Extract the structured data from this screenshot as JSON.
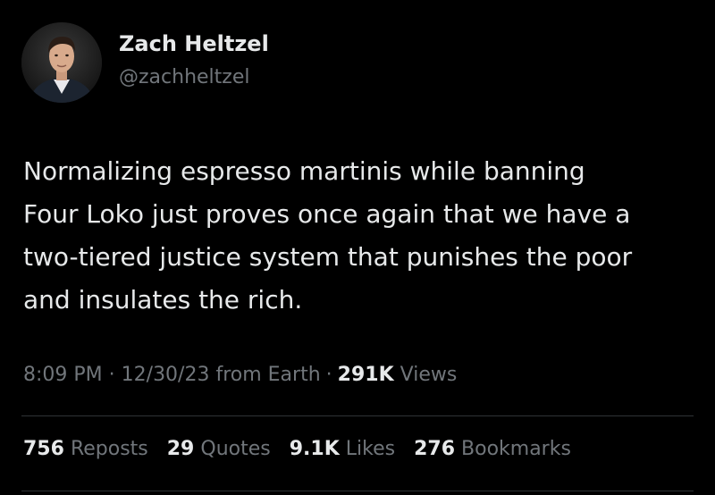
{
  "author": {
    "display_name": "Zach Heltzel",
    "handle": "@zachheltzel",
    "avatar_icon": "profile-photo"
  },
  "tweet": {
    "text": "Normalizing espresso martinis while banning\nFour Loko just proves once again that we have a\ntwo-tiered justice system that punishes the poor\nand insulates the rich."
  },
  "meta": {
    "time": "8:09 PM",
    "separator": "·",
    "date": "12/30/23",
    "source": "from Earth",
    "views_count": "291K",
    "views_label": "Views"
  },
  "stats": {
    "reposts_count": "756",
    "reposts_label": "Reposts",
    "quotes_count": "29",
    "quotes_label": "Quotes",
    "likes_count": "9.1K",
    "likes_label": "Likes",
    "bookmarks_count": "276",
    "bookmarks_label": "Bookmarks"
  },
  "colors": {
    "background": "#000000",
    "primary_text": "#e7e9ea",
    "secondary_text": "#71767b",
    "divider": "#2f3336"
  }
}
